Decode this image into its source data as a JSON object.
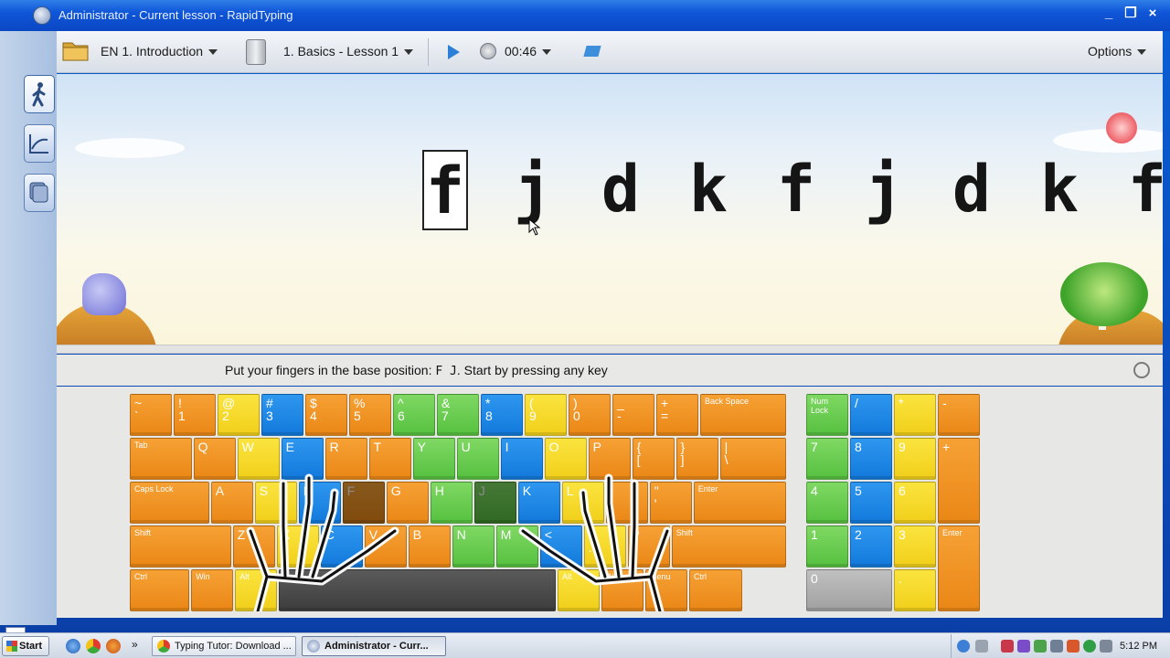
{
  "window": {
    "title": "Administrator - Current lesson - RapidTyping",
    "controls": [
      "_",
      "❐",
      "×"
    ]
  },
  "toolbar": {
    "course": "EN 1. Introduction",
    "lesson": "1. Basics - Lesson 1",
    "timer": "00:46",
    "options": "Options"
  },
  "sidebar": {
    "items": [
      {
        "name": "lesson",
        "icon": "walking-person-icon"
      },
      {
        "name": "statistics",
        "icon": "chart-icon"
      },
      {
        "name": "editor",
        "icon": "stack-icon"
      }
    ]
  },
  "lesson": {
    "characters": [
      "f",
      "j",
      "d",
      "k",
      "f",
      "j",
      "d",
      "k",
      "f"
    ],
    "current_index": 0
  },
  "status": {
    "prefix": "Put your fingers in the base position:",
    "keys": "F J",
    "suffix": ". Start by pressing any key"
  },
  "keyboard": {
    "rows": [
      [
        {
          "label": "~\n`",
          "color": "orange"
        },
        {
          "label": "!\n1",
          "color": "orange"
        },
        {
          "label": "@\n2",
          "color": "yellow"
        },
        {
          "label": "#\n3",
          "color": "blue"
        },
        {
          "label": "$\n4",
          "color": "orange"
        },
        {
          "label": "%\n5",
          "color": "orange"
        },
        {
          "label": "^\n6",
          "color": "green"
        },
        {
          "label": "&\n7",
          "color": "green"
        },
        {
          "label": "*\n8",
          "color": "blue"
        },
        {
          "label": "(\n9",
          "color": "yellow"
        },
        {
          "label": ")\n0",
          "color": "orange"
        },
        {
          "label": "_\n-",
          "color": "orange"
        },
        {
          "label": "+\n=",
          "color": "orange"
        },
        {
          "label": "Back Space",
          "color": "orange",
          "small": true
        }
      ],
      [
        {
          "label": "Tab",
          "color": "orange",
          "small": true
        },
        {
          "label": "Q",
          "color": "orange"
        },
        {
          "label": "W",
          "color": "yellow"
        },
        {
          "label": "E",
          "color": "blue"
        },
        {
          "label": "R",
          "color": "orange"
        },
        {
          "label": "T",
          "color": "orange"
        },
        {
          "label": "Y",
          "color": "green"
        },
        {
          "label": "U",
          "color": "green"
        },
        {
          "label": "I",
          "color": "blue"
        },
        {
          "label": "O",
          "color": "yellow"
        },
        {
          "label": "P",
          "color": "orange"
        },
        {
          "label": "{\n[",
          "color": "orange"
        },
        {
          "label": "}\n]",
          "color": "orange"
        },
        {
          "label": "|\n\\",
          "color": "orange"
        }
      ],
      [
        {
          "label": "Caps Lock",
          "color": "orange",
          "small": true
        },
        {
          "label": "A",
          "color": "orange"
        },
        {
          "label": "S",
          "color": "yellow"
        },
        {
          "label": "D",
          "color": "blue"
        },
        {
          "label": "F",
          "color": "orange",
          "dark": true
        },
        {
          "label": "G",
          "color": "orange"
        },
        {
          "label": "H",
          "color": "green"
        },
        {
          "label": "J",
          "color": "green",
          "dark": true
        },
        {
          "label": "K",
          "color": "blue"
        },
        {
          "label": "L",
          "color": "yellow"
        },
        {
          "label": ":\n;",
          "color": "orange"
        },
        {
          "label": "\"\n'",
          "color": "orange"
        },
        {
          "label": "Enter",
          "color": "orange",
          "small": true
        }
      ],
      [
        {
          "label": "Shift",
          "color": "orange",
          "small": true
        },
        {
          "label": "Z",
          "color": "orange"
        },
        {
          "label": "X",
          "color": "yellow"
        },
        {
          "label": "C",
          "color": "blue"
        },
        {
          "label": "V",
          "color": "orange"
        },
        {
          "label": "B",
          "color": "orange"
        },
        {
          "label": "N",
          "color": "green"
        },
        {
          "label": "M",
          "color": "green"
        },
        {
          "label": "<\n,",
          "color": "blue"
        },
        {
          "label": ">\n.",
          "color": "yellow"
        },
        {
          "label": "?\n/",
          "color": "orange"
        },
        {
          "label": "Shift",
          "color": "orange",
          "small": true
        }
      ],
      [
        {
          "label": "Ctrl",
          "color": "orange",
          "small": true
        },
        {
          "label": "Win",
          "color": "orange",
          "small": true
        },
        {
          "label": "Alt",
          "color": "yellow",
          "small": true
        },
        {
          "label": "",
          "color": "space"
        },
        {
          "label": "Alt",
          "color": "yellow",
          "small": true
        },
        {
          "label": "Win",
          "color": "orange",
          "small": true
        },
        {
          "label": "Menu",
          "color": "orange",
          "small": true
        },
        {
          "label": "Ctrl",
          "color": "orange",
          "small": true
        }
      ]
    ],
    "numpad": [
      {
        "label": "Num\nLock",
        "color": "green",
        "small": true
      },
      {
        "label": "/",
        "color": "blue"
      },
      {
        "label": "*",
        "color": "yellow"
      },
      {
        "label": "-",
        "color": "orange"
      },
      {
        "label": "7",
        "color": "green"
      },
      {
        "label": "8",
        "color": "blue"
      },
      {
        "label": "9",
        "color": "yellow"
      },
      {
        "label": "+",
        "color": "orange"
      },
      {
        "label": "4",
        "color": "green"
      },
      {
        "label": "5",
        "color": "blue"
      },
      {
        "label": "6",
        "color": "yellow"
      },
      {
        "label": "1",
        "color": "green"
      },
      {
        "label": "2",
        "color": "blue"
      },
      {
        "label": "3",
        "color": "yellow"
      },
      {
        "label": "Enter",
        "color": "orange",
        "small": true
      },
      {
        "label": "0",
        "color": "gray"
      },
      {
        "label": ".",
        "color": "yellow"
      }
    ]
  },
  "taskbar": {
    "start": "Start",
    "quicklaunch_more": "»",
    "tasks": [
      {
        "label": "Typing Tutor: Download ...",
        "active": false
      },
      {
        "label": "Administrator - Curr...",
        "active": true
      }
    ],
    "clock": "5:12 PM"
  },
  "colors": {
    "orange": "#ea8716",
    "yellow": "#f1cf1a",
    "green": "#56c13f",
    "blue": "#1279db",
    "title_bar": "#0a47c4"
  }
}
